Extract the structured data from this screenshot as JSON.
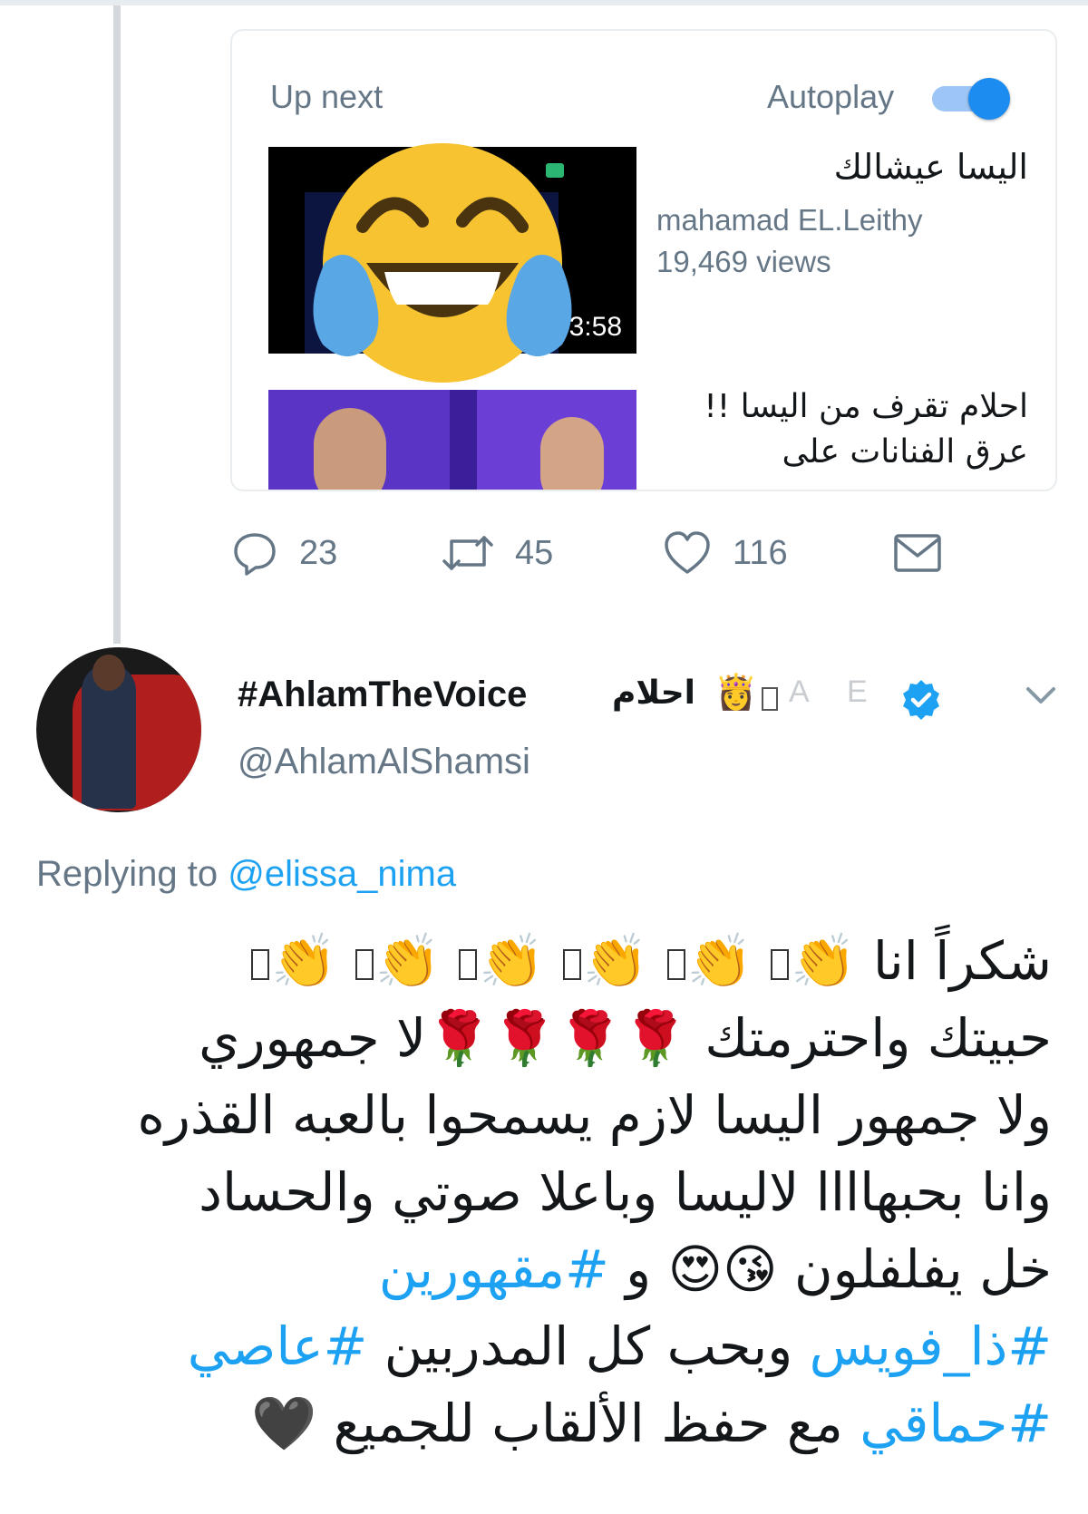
{
  "card": {
    "up_next_label": "Up next",
    "autoplay_label": "Autoplay",
    "autoplay_on": true,
    "videos": [
      {
        "title": "اليسا عيشالك",
        "channel": "mahamad EL.Leithy",
        "views": "19,469 views",
        "duration": "3:58"
      },
      {
        "title": "احلام تقرف من اليسا !! عرق الفنانات على"
      }
    ]
  },
  "actions": {
    "replies": "23",
    "retweets": "45",
    "likes": "116"
  },
  "tweet": {
    "display_name": "#AhlamTheVoice",
    "display_name_arabic": "احلام",
    "display_name_emoji": "👸",
    "handle": "@AhlamAlShamsi",
    "replying_prefix": "Replying to",
    "replying_to": "@elissa_nima",
    "lines": {
      "l1_text": "شكراً انا",
      "l1_emoji": "👏",
      "l2_text": "حبيتك واحترمتك",
      "l2_emoji": "🌹",
      "l2_tail": "لا جمهوري",
      "l3": "ولا جمهور اليسا لازم يسمحوا بالعبه القذره",
      "l4": "وانا بحبهاااا لاليسا وباعلا صوتي والحساد",
      "l5_text": "خل يفلفلون",
      "l5_emoji": "😘😍",
      "l5_and": "و",
      "hashtag1": "#مقهورين",
      "hashtag2": "#ذا_فويس",
      "l6_text": "وبحب كل المدربين",
      "hashtag3": "#عاصي",
      "hashtag4": "#حماقي",
      "l7_text": "مع حفظ الألقاب للجميع",
      "l7_emoji": "🖤"
    }
  },
  "colors": {
    "link": "#1da1f2",
    "secondary_text": "#657786",
    "toggle_on": "#1d8cf0",
    "emoji_face": "#f7c331",
    "tears": "#5aa7e6"
  },
  "icons": [
    "reply-icon",
    "retweet-icon",
    "like-icon",
    "dm-icon",
    "verified-icon",
    "chevron-down-icon",
    "face-with-tears-of-joy-icon"
  ]
}
